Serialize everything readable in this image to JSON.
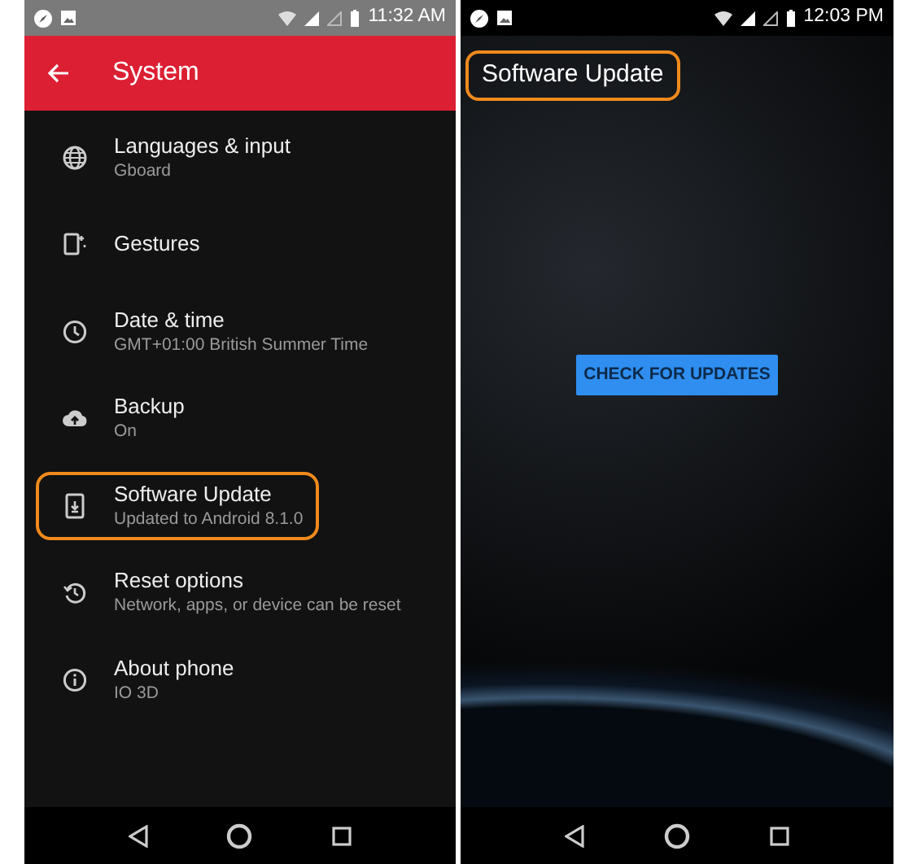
{
  "left_screen": {
    "status_bar": {
      "time": "11:32 AM"
    },
    "app_bar": {
      "title": "System"
    },
    "items": [
      {
        "title": "Languages & input",
        "subtitle": "Gboard",
        "highlighted": false
      },
      {
        "title": "Gestures",
        "highlighted": false
      },
      {
        "title": "Date & time",
        "subtitle": "GMT+01:00 British Summer Time",
        "highlighted": false
      },
      {
        "title": "Backup",
        "subtitle": "On",
        "highlighted": false
      },
      {
        "title": "Software Update",
        "subtitle": "Updated to Android 8.1.0",
        "highlighted": true
      },
      {
        "title": "Reset options",
        "subtitle": "Network, apps, or device can be reset",
        "highlighted": false
      },
      {
        "title": "About phone",
        "subtitle": "IO 3D",
        "highlighted": false
      }
    ]
  },
  "right_screen": {
    "status_bar": {
      "time": "12:03 PM"
    },
    "title": {
      "text": "Software Update",
      "highlighted": true
    },
    "button": "CHECK FOR UPDATES"
  }
}
